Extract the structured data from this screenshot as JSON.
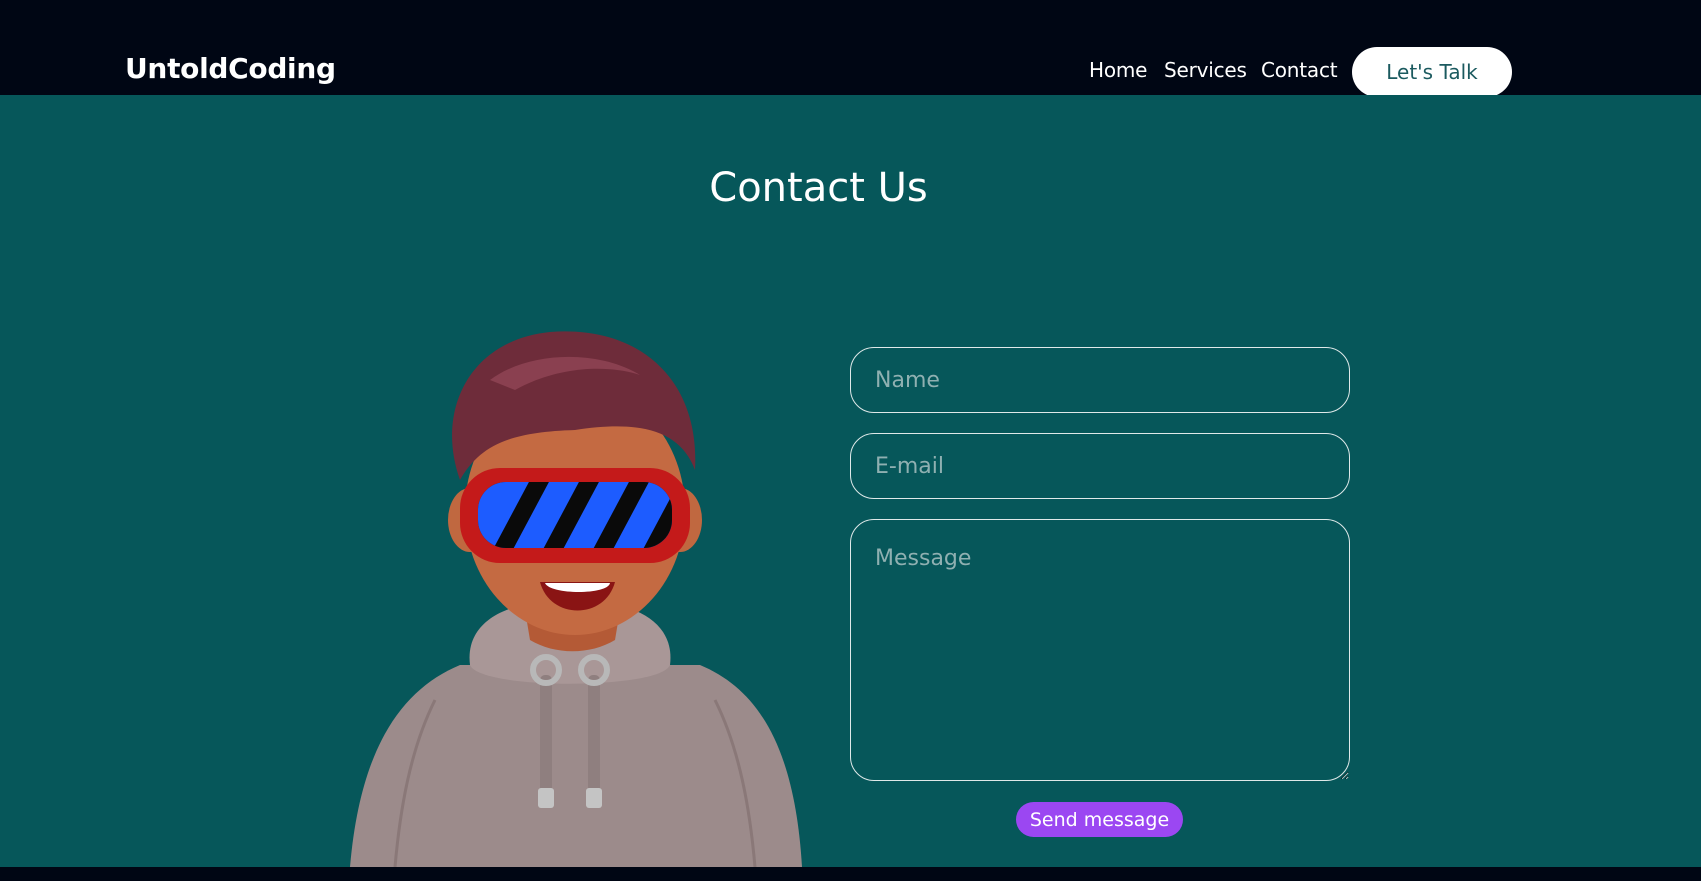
{
  "brand": {
    "name": "UntoldCoding"
  },
  "nav": {
    "links": [
      {
        "label": "Home"
      },
      {
        "label": "Services"
      },
      {
        "label": "Contact"
      }
    ],
    "cta_label": "Let's Talk"
  },
  "contact": {
    "title": "Contact Us",
    "name_placeholder": "Name",
    "email_placeholder": "E-mail",
    "message_placeholder": "Message",
    "submit_label": "Send message"
  },
  "colors": {
    "header_bg": "#000614",
    "section_bg": "#06575a",
    "button_accent": "#9b47f2",
    "cta_text": "#1b5a5f"
  },
  "images": {
    "avatar": "3d-avatar-vr-headset"
  }
}
